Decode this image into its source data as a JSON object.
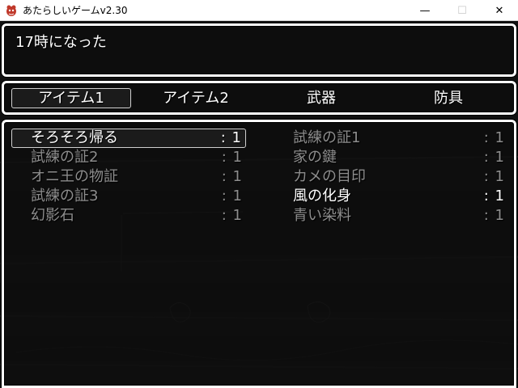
{
  "window": {
    "title": "あたらしいゲームv2.30",
    "minimize_glyph": "—",
    "maximize_glyph": "☐",
    "close_glyph": "✕"
  },
  "message": {
    "text": "17時になった"
  },
  "categories": [
    {
      "label": "アイテム1",
      "selected": true
    },
    {
      "label": "アイテム2",
      "selected": false
    },
    {
      "label": "武器",
      "selected": false
    },
    {
      "label": "防具",
      "selected": false
    }
  ],
  "items": [
    {
      "name": "そろそろ帰る",
      "count": ": 1",
      "enabled": true,
      "selected": true
    },
    {
      "name": "試練の証1",
      "count": ": 1",
      "enabled": false,
      "selected": false
    },
    {
      "name": "試練の証2",
      "count": ": 1",
      "enabled": false,
      "selected": false
    },
    {
      "name": "家の鍵",
      "count": ": 1",
      "enabled": false,
      "selected": false
    },
    {
      "name": "オニ王の物証",
      "count": ": 1",
      "enabled": false,
      "selected": false
    },
    {
      "name": "カメの目印",
      "count": ": 1",
      "enabled": false,
      "selected": false
    },
    {
      "name": "試練の証3",
      "count": ": 1",
      "enabled": false,
      "selected": false
    },
    {
      "name": "風の化身",
      "count": ": 1",
      "enabled": true,
      "selected": false
    },
    {
      "name": "幻影石",
      "count": ": 1",
      "enabled": false,
      "selected": false
    },
    {
      "name": "青い染料",
      "count": ": 1",
      "enabled": false,
      "selected": false
    }
  ],
  "colors": {
    "text_enabled": "#ffffff",
    "text_disabled": "#8d8d8d",
    "window_border": "#ffffff"
  }
}
